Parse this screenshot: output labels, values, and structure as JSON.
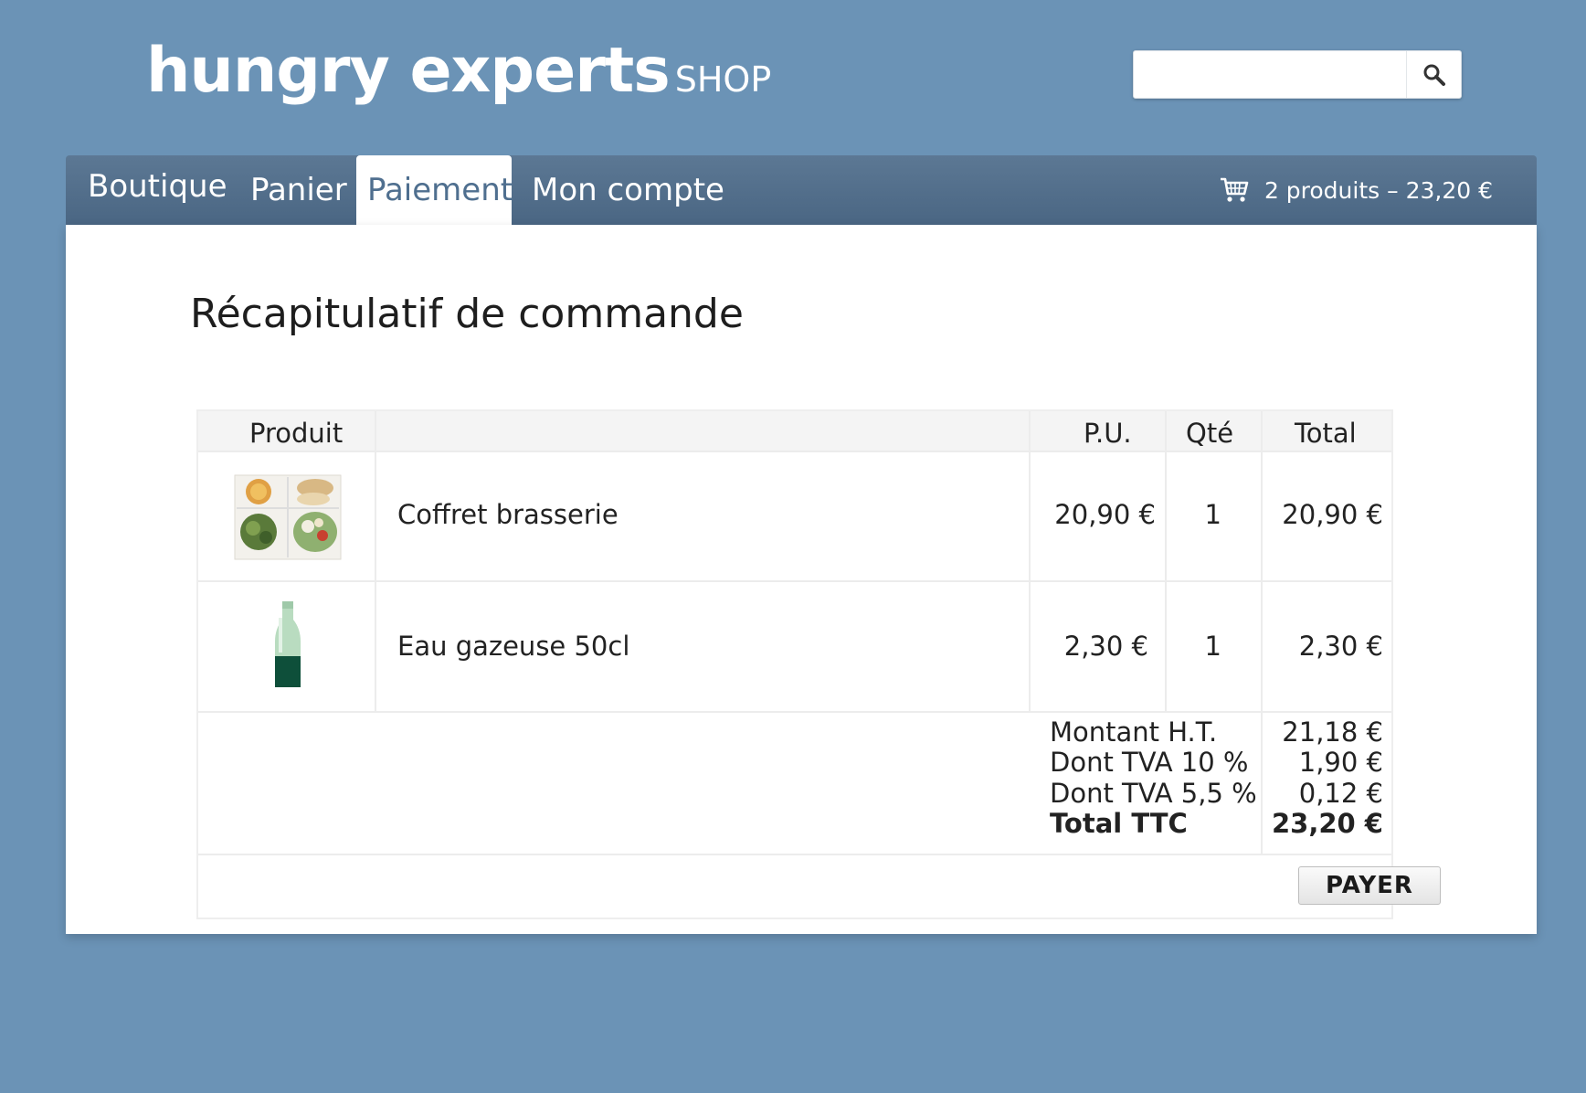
{
  "header": {
    "brand_name": "hungry experts",
    "brand_suffix": "SHOP",
    "search_placeholder": ""
  },
  "nav": {
    "tabs": [
      {
        "label": "Boutique"
      },
      {
        "label": "Panier"
      },
      {
        "label": "Paiement",
        "active": true
      },
      {
        "label": "Mon compte"
      }
    ],
    "cart_summary": "2 produits – 23,20 €"
  },
  "main": {
    "title": "Récapitulatif de commande",
    "table": {
      "columns": [
        "Produit",
        "",
        "P.U.",
        "Qté",
        "Total"
      ],
      "rows": [
        {
          "name": "Coffret brasserie",
          "unit_price": "20,90 €",
          "qty": "1",
          "total": "20,90 €",
          "thumb": "meal-box-thumbnail"
        },
        {
          "name": "Eau gazeuse 50cl",
          "unit_price": "2,30 €",
          "qty": "1",
          "total": "2,30 €",
          "thumb": "water-bottle-thumbnail"
        }
      ],
      "summary": [
        {
          "label": "Montant H.T.",
          "value": "21,18 €"
        },
        {
          "label": "Dont TVA 10 %",
          "value": "1,90 €"
        },
        {
          "label": "Dont TVA 5,5 %",
          "value": "0,12 €"
        },
        {
          "label": "Total TTC",
          "value": "23,20 €",
          "bold": true
        }
      ]
    },
    "pay_label": "PAYER"
  },
  "colors": {
    "background": "#6b93b6",
    "nav_bar": "#4f6b88",
    "active_tab_text": "#4f6f8f"
  }
}
